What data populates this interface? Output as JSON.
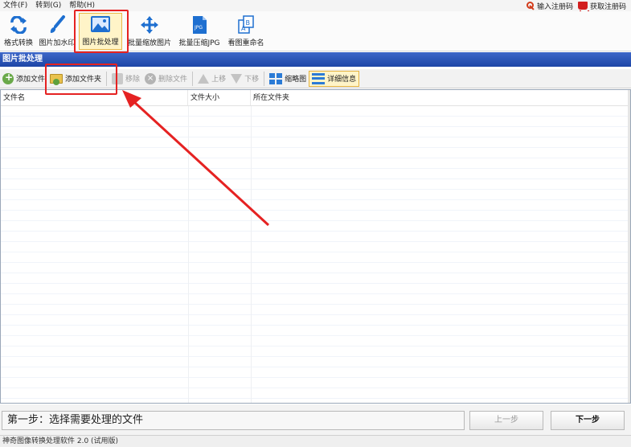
{
  "menu": [
    "文件(F)",
    "转到(G)",
    "帮助(H)"
  ],
  "menu_right": {
    "register": "输入注册码",
    "buy": "获取注册码"
  },
  "ribbon": [
    {
      "label": "格式转换",
      "icon": "convert-icon"
    },
    {
      "label": "图片加水印",
      "icon": "brush-icon"
    },
    {
      "label": "图片批处理",
      "icon": "image-icon",
      "active": true
    },
    {
      "label": "批量缩放图片",
      "icon": "resize-arrows-icon"
    },
    {
      "label": "批量压缩JPG",
      "icon": "jpg-file-icon"
    },
    {
      "label": "看图重命名",
      "icon": "rename-icon"
    }
  ],
  "panel_title": "图片批处理",
  "toolbar": {
    "add_file": "添加文件",
    "add_folder": "添加文件夹",
    "remove": "移除",
    "delete_file": "删除文件",
    "move_up": "上移",
    "move_down": "下移",
    "thumbnail": "缩略图",
    "details": "详细信息"
  },
  "table": {
    "columns": [
      "文件名",
      "文件大小",
      "所在文件夹"
    ],
    "rows": []
  },
  "step": {
    "text": "第一步：选择需要处理的文件",
    "prev": "上一步",
    "next": "下一步"
  },
  "status": "神奇图像转换处理软件 2.0 (试用版)",
  "colors": {
    "accent": "#1d45a6",
    "highlight_box": "#e52222",
    "active_bg": "#fff4c8"
  }
}
